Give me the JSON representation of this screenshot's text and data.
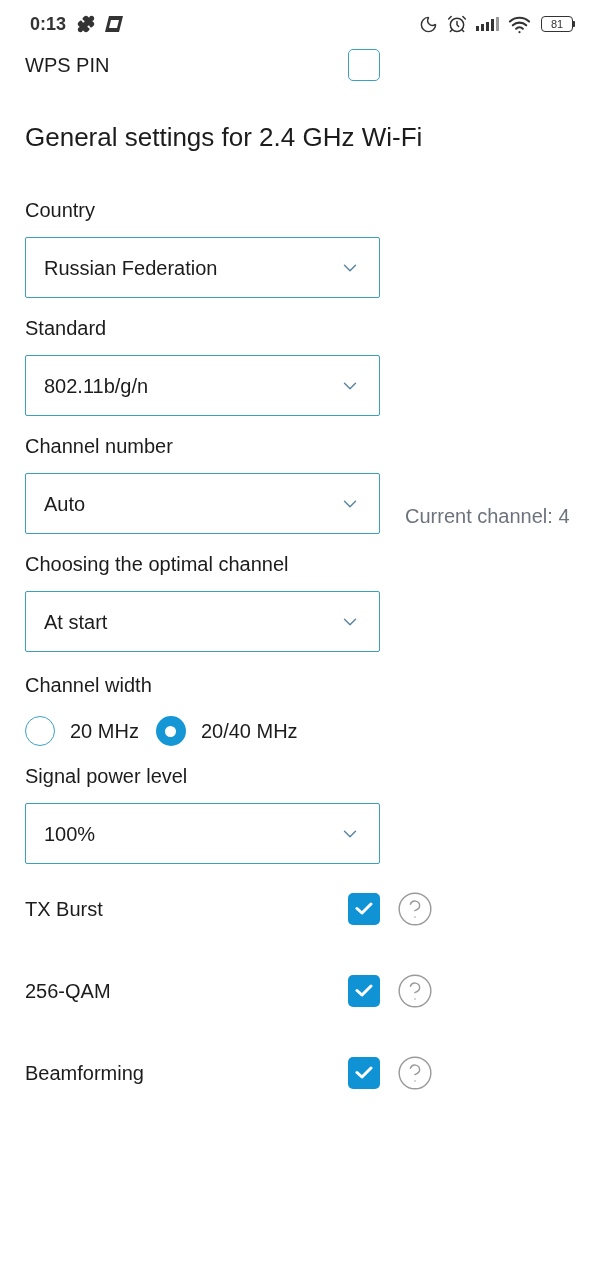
{
  "status_bar": {
    "time": "0:13",
    "battery": "81"
  },
  "wps_pin": {
    "label": "WPS PIN",
    "checked": false
  },
  "section_title": "General settings for 2.4 GHz Wi-Fi",
  "fields": [
    {
      "kind": "select",
      "label": "Country",
      "value": "Russian Federation"
    },
    {
      "kind": "select",
      "label": "Standard",
      "value": "802.11b/g/n"
    },
    {
      "kind": "select",
      "label": "Channel number",
      "value": "Auto",
      "note": "Current channel: 4"
    },
    {
      "kind": "select",
      "label": "Choosing the optimal channel",
      "value": "At start"
    },
    {
      "kind": "radio",
      "label": "Channel width",
      "options": [
        {
          "label": "20 MHz",
          "selected": false
        },
        {
          "label": "20/40 MHz",
          "selected": true
        }
      ]
    },
    {
      "kind": "select",
      "label": "Signal power level",
      "value": "100%"
    }
  ],
  "toggles": [
    {
      "label": "TX Burst",
      "checked": true
    },
    {
      "label": "256-QAM",
      "checked": true
    },
    {
      "label": "Beamforming",
      "checked": true
    }
  ]
}
